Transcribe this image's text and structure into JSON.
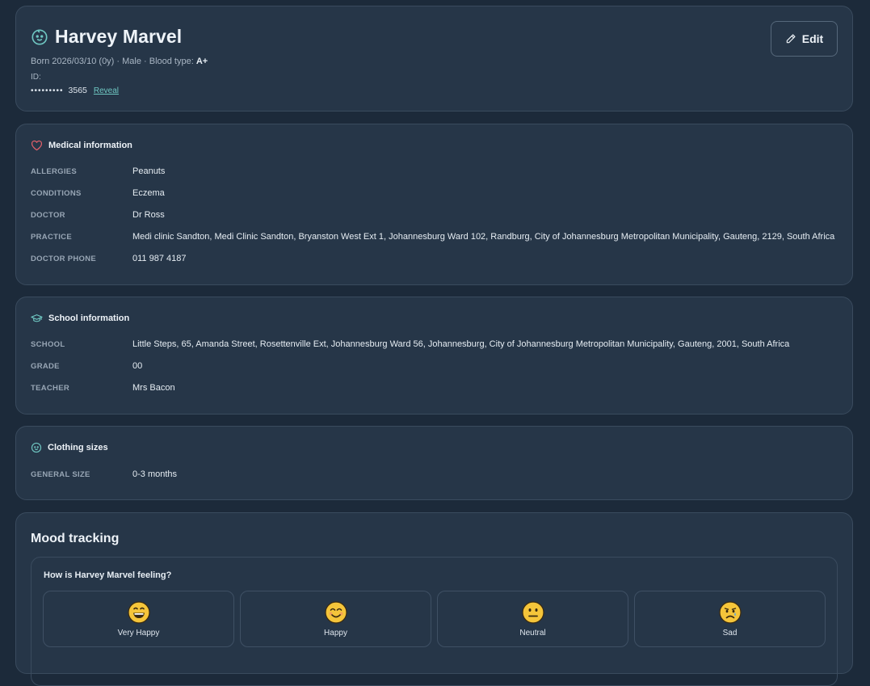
{
  "header": {
    "name": "Harvey Marvel",
    "born": "Born 2026/03/10 (0y) · Male · Blood type:",
    "blood_type": "A+",
    "id_label": "ID:",
    "id_mask": "•••••••••",
    "id_last": "3565",
    "reveal_label": "Reveal",
    "edit_label": "Edit"
  },
  "medical": {
    "title": "Medical information",
    "rows": [
      {
        "label": "ALLERGIES",
        "value": "Peanuts"
      },
      {
        "label": "CONDITIONS",
        "value": "Eczema"
      },
      {
        "label": "DOCTOR",
        "value": "Dr Ross"
      },
      {
        "label": "PRACTICE",
        "value": "Medi clinic Sandton, Medi Clinic Sandton, Bryanston West Ext 1, Johannesburg Ward 102, Randburg, City of Johannesburg Metropolitan Municipality, Gauteng, 2129, South Africa"
      },
      {
        "label": "DOCTOR PHONE",
        "value": "011 987 4187"
      }
    ]
  },
  "school": {
    "title": "School information",
    "rows": [
      {
        "label": "SCHOOL",
        "value": "Little Steps, 65, Amanda Street, Rosettenville Ext, Johannesburg Ward 56, Johannesburg, City of Johannesburg Metropolitan Municipality, Gauteng, 2001, South Africa"
      },
      {
        "label": "GRADE",
        "value": "00"
      },
      {
        "label": "TEACHER",
        "value": "Mrs Bacon"
      }
    ]
  },
  "clothing": {
    "title": "Clothing sizes",
    "rows": [
      {
        "label": "GENERAL SIZE",
        "value": "0-3 months"
      }
    ]
  },
  "mood": {
    "title": "Mood tracking",
    "question": "How is Harvey Marvel feeling?",
    "options": [
      {
        "label": "Very Happy",
        "icon": "very-happy-emoji-icon"
      },
      {
        "label": "Happy",
        "icon": "happy-emoji-icon"
      },
      {
        "label": "Neutral",
        "icon": "neutral-emoji-icon"
      },
      {
        "label": "Sad",
        "icon": "sad-emoji-icon"
      }
    ]
  },
  "colors": {
    "background": "#1c2a3a",
    "card": "#263648",
    "accent_teal": "#6fc7c2",
    "heart_red": "#e0606a",
    "emoji_yellow": "#f5c53a"
  }
}
